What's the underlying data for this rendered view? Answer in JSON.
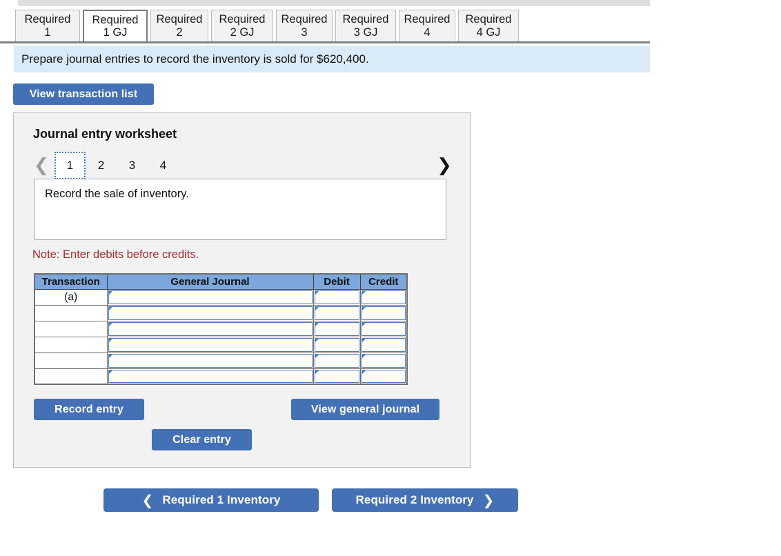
{
  "tabs": [
    {
      "line1": "Required",
      "line2": "1",
      "active": false
    },
    {
      "line1": "Required",
      "line2": "1 GJ",
      "active": true
    },
    {
      "line1": "Required",
      "line2": "2",
      "active": false
    },
    {
      "line1": "Required",
      "line2": "2 GJ",
      "active": false
    },
    {
      "line1": "Required",
      "line2": "3",
      "active": false
    },
    {
      "line1": "Required",
      "line2": "3 GJ",
      "active": false
    },
    {
      "line1": "Required",
      "line2": "4",
      "active": false
    },
    {
      "line1": "Required",
      "line2": "4 GJ",
      "active": false
    }
  ],
  "instruction": "Prepare journal entries to record the inventory is sold for $620,400.",
  "view_transaction_list_label": "View transaction list",
  "worksheet": {
    "title": "Journal entry worksheet",
    "pager": {
      "prev_icon": "chevron-left-icon",
      "next_icon": "chevron-right-icon",
      "pages": [
        "1",
        "2",
        "3",
        "4"
      ],
      "active_page": "1"
    },
    "description": "Record the sale of inventory.",
    "note": "Note: Enter debits before credits.",
    "table": {
      "headers": [
        "Transaction",
        "General Journal",
        "Debit",
        "Credit"
      ],
      "rows": [
        {
          "transaction": "(a)",
          "general_journal": "",
          "debit": "",
          "credit": ""
        },
        {
          "transaction": "",
          "general_journal": "",
          "debit": "",
          "credit": ""
        },
        {
          "transaction": "",
          "general_journal": "",
          "debit": "",
          "credit": ""
        },
        {
          "transaction": "",
          "general_journal": "",
          "debit": "",
          "credit": ""
        },
        {
          "transaction": "",
          "general_journal": "",
          "debit": "",
          "credit": ""
        },
        {
          "transaction": "",
          "general_journal": "",
          "debit": "",
          "credit": ""
        }
      ]
    },
    "buttons": {
      "record_entry": "Record entry",
      "clear_entry": "Clear entry",
      "view_general_journal": "View general journal"
    }
  },
  "bottom_nav": {
    "prev_label": "Required 1 Inventory",
    "next_label": "Required 2 Inventory",
    "prev_icon": "chevron-left-icon",
    "next_icon": "chevron-right-icon"
  },
  "colors": {
    "accent_blue": "#4471b5",
    "table_header_blue": "#7ba7dc",
    "instruction_bg": "#daeaf7",
    "note_red": "#a02c2c",
    "panel_bg": "#f2f2f2"
  }
}
